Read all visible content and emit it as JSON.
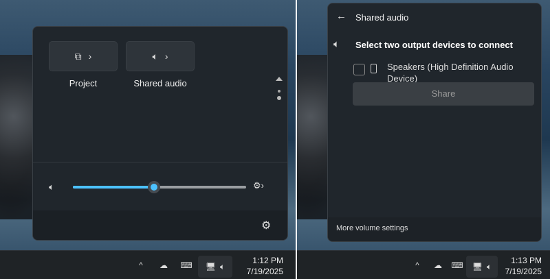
{
  "left": {
    "tiles": [
      {
        "label": "Project",
        "icon": "project-icon"
      },
      {
        "label": "Shared audio",
        "icon": "shared-audio-icon"
      }
    ],
    "volume": {
      "level_percent": 47,
      "accent": "#4cc2ff"
    },
    "taskbar": {
      "time": "1:12 PM",
      "date": "7/19/2025"
    }
  },
  "right": {
    "header": {
      "title": "Shared audio"
    },
    "prompt": "Select two output devices to connect",
    "devices": [
      {
        "label": "Speakers (High Definition Audio Device)",
        "checked": false
      }
    ],
    "share_button": "Share",
    "footer_link": "More volume settings",
    "taskbar": {
      "time": "1:13 PM",
      "date": "7/19/2025"
    }
  }
}
